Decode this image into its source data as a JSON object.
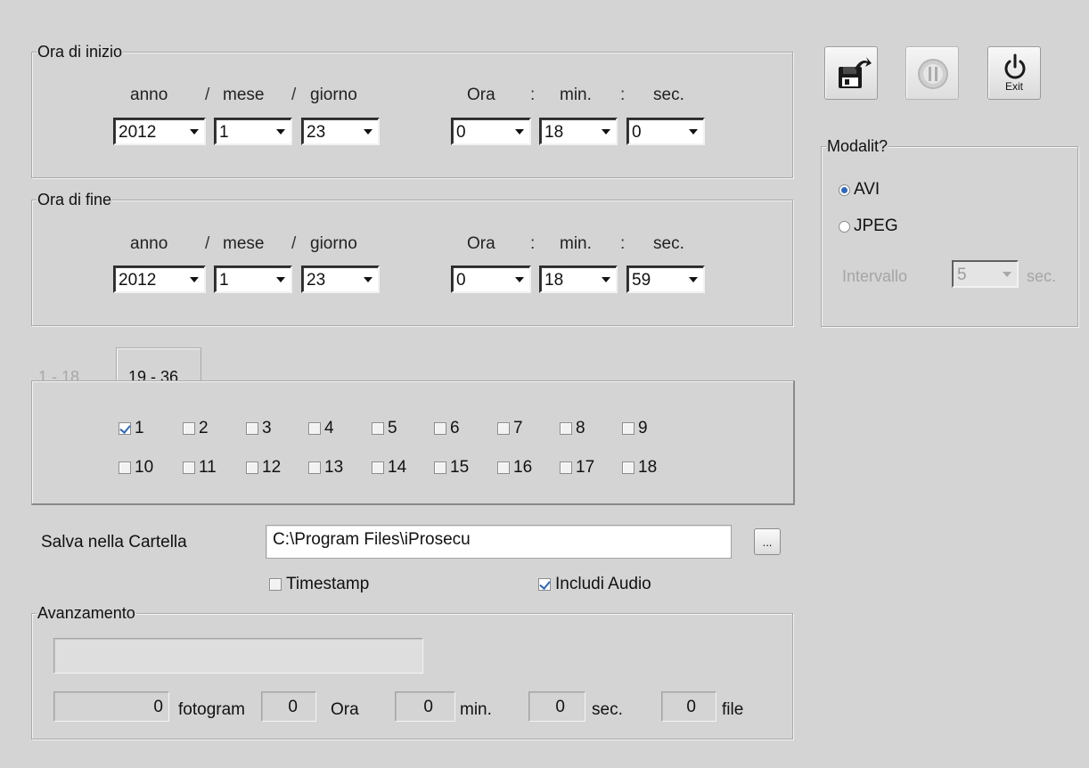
{
  "start_group": {
    "legend": "Ora di inizio",
    "labels": {
      "year": "anno",
      "month": "mese",
      "day": "giorno",
      "hour": "Ora",
      "min": "min.",
      "sec": "sec.",
      "slash": "/",
      "colon": ":"
    },
    "values": {
      "year": "2012",
      "month": "1",
      "day": "23",
      "hour": "0",
      "min": "18",
      "sec": "0"
    }
  },
  "end_group": {
    "legend": "Ora di fine",
    "labels": {
      "year": "anno",
      "month": "mese",
      "day": "giorno",
      "hour": "Ora",
      "min": "min.",
      "sec": "sec.",
      "slash": "/",
      "colon": ":"
    },
    "values": {
      "year": "2012",
      "month": "1",
      "day": "23",
      "hour": "0",
      "min": "18",
      "sec": "59"
    }
  },
  "toolbar": {
    "buttons": [
      {
        "name": "save",
        "icon": "floppy-export-icon"
      },
      {
        "name": "stop",
        "icon": "stop-disabled-icon",
        "disabled": true
      },
      {
        "name": "exit",
        "icon": "power-icon",
        "label": "Exit"
      }
    ]
  },
  "mode": {
    "legend": "Modalit?",
    "options": [
      "AVI",
      "JPEG"
    ],
    "selected": "AVI",
    "interval_label": "Intervallo",
    "interval_value": "5",
    "interval_unit": "sec."
  },
  "channels": {
    "tabs": [
      "1 - 18",
      "19 - 36"
    ],
    "active_tab": "19 - 36",
    "items": [
      {
        "label": "1",
        "checked": true
      },
      {
        "label": "2",
        "checked": false
      },
      {
        "label": "3",
        "checked": false
      },
      {
        "label": "4",
        "checked": false
      },
      {
        "label": "5",
        "checked": false
      },
      {
        "label": "6",
        "checked": false
      },
      {
        "label": "7",
        "checked": false
      },
      {
        "label": "8",
        "checked": false
      },
      {
        "label": "9",
        "checked": false
      },
      {
        "label": "10",
        "checked": false
      },
      {
        "label": "11",
        "checked": false
      },
      {
        "label": "12",
        "checked": false
      },
      {
        "label": "13",
        "checked": false
      },
      {
        "label": "14",
        "checked": false
      },
      {
        "label": "15",
        "checked": false
      },
      {
        "label": "16",
        "checked": false
      },
      {
        "label": "17",
        "checked": false
      },
      {
        "label": "18",
        "checked": false
      }
    ]
  },
  "save": {
    "label": "Salva nella Cartella",
    "path": "C:\\Program Files\\iProsecu",
    "browse_label": "...",
    "timestamp_label": "Timestamp",
    "timestamp_checked": false,
    "audio_label": "Includi Audio",
    "audio_checked": true
  },
  "progress": {
    "legend": "Avanzamento",
    "percent": 0,
    "frames": "0",
    "frames_unit": "fotogram",
    "hours": "0",
    "hours_unit": "Ora",
    "minutes": "0",
    "minutes_unit": "min.",
    "seconds": "0",
    "seconds_unit": "sec.",
    "files": "0",
    "files_unit": "file"
  }
}
